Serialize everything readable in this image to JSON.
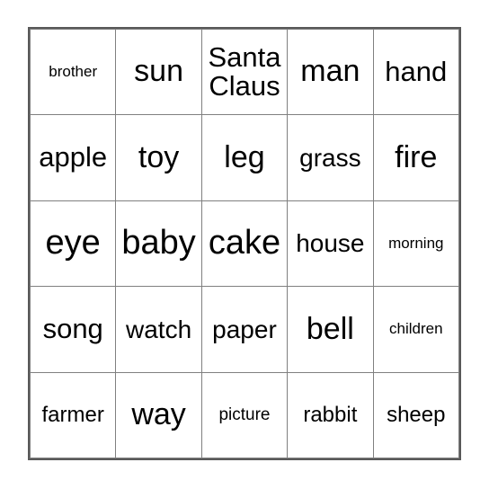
{
  "card": {
    "type": "bingo-card",
    "rows": 5,
    "columns": 5,
    "border_color": "#595959",
    "gridline_color": "#808080",
    "text_color": "#000000",
    "background_color": "#ffffff",
    "cells": [
      [
        {
          "label": "brother",
          "size": "xxs"
        },
        {
          "label": "sun",
          "size": "lg"
        },
        {
          "label": "Santa Claus",
          "size": "ml"
        },
        {
          "label": "man",
          "size": "lg"
        },
        {
          "label": "hand",
          "size": "ml"
        }
      ],
      [
        {
          "label": "apple",
          "size": "ml"
        },
        {
          "label": "toy",
          "size": "lg"
        },
        {
          "label": "leg",
          "size": "lg"
        },
        {
          "label": "grass",
          "size": "md"
        },
        {
          "label": "fire",
          "size": "lg"
        }
      ],
      [
        {
          "label": "eye",
          "size": "xl"
        },
        {
          "label": "baby",
          "size": "xl"
        },
        {
          "label": "cake",
          "size": "xl"
        },
        {
          "label": "house",
          "size": "md"
        },
        {
          "label": "morning",
          "size": "xxs"
        }
      ],
      [
        {
          "label": "song",
          "size": "ml"
        },
        {
          "label": "watch",
          "size": "md"
        },
        {
          "label": "paper",
          "size": "md"
        },
        {
          "label": "bell",
          "size": "lg"
        },
        {
          "label": "children",
          "size": "xxs"
        }
      ],
      [
        {
          "label": "farmer",
          "size": "sm"
        },
        {
          "label": "way",
          "size": "lg"
        },
        {
          "label": "picture",
          "size": "xs"
        },
        {
          "label": "rabbit",
          "size": "sm"
        },
        {
          "label": "sheep",
          "size": "sm"
        }
      ]
    ]
  }
}
